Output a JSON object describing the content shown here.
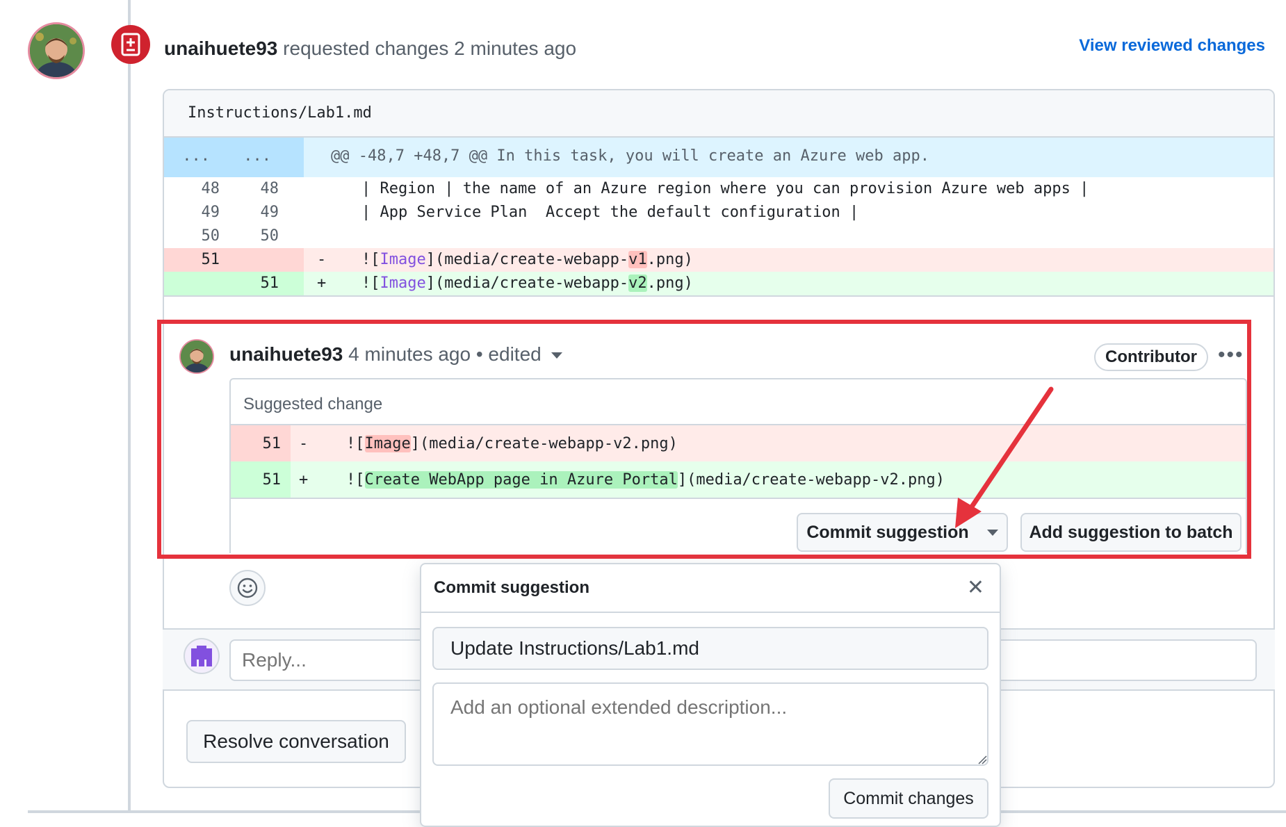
{
  "review": {
    "username": "unaihuete93",
    "action": "requested changes",
    "time": "2 minutes ago",
    "view_link": "View reviewed changes"
  },
  "file": {
    "name": "Instructions/Lab1.md",
    "hunk_left": "...",
    "hunk_right": "...",
    "hunk_header": "@@ -48,7 +48,7 @@ In this task, you will create an Azure web app.",
    "lines": [
      {
        "old": "48",
        "new": "48",
        "marker": "",
        "text": "| Region | the name of an Azure region where you can provision Azure web apps |",
        "type": "ctx"
      },
      {
        "old": "49",
        "new": "49",
        "marker": "",
        "text": "| App Service Plan  Accept the default configuration |",
        "type": "ctx"
      },
      {
        "old": "50",
        "new": "50",
        "marker": "",
        "text": "",
        "type": "ctx"
      },
      {
        "old": "51",
        "new": "",
        "marker": "-",
        "type": "del",
        "pre": "![",
        "link": "Image",
        "mid": "](media/create-webapp-",
        "hl": "v1",
        "post": ".png)"
      },
      {
        "old": "",
        "new": "51",
        "marker": "+",
        "type": "add",
        "pre": "![",
        "link": "Image",
        "mid": "](media/create-webapp-",
        "hl": "v2",
        "post": ".png)"
      }
    ]
  },
  "comment": {
    "username": "unaihuete93",
    "time": "4 minutes ago",
    "edited": "• edited",
    "role_badge": "Contributor",
    "more": "•••",
    "suggestion_title": "Suggested change",
    "del_line": {
      "num": "51",
      "marker": "-",
      "pre": "![",
      "hl": "Image",
      "post": "](media/create-webapp-v2.png)"
    },
    "add_line": {
      "num": "51",
      "marker": "+",
      "pre": "![",
      "hl": "Create WebApp page in Azure Portal",
      "post": "](media/create-webapp-v2.png)"
    },
    "commit_button": "Commit suggestion",
    "batch_button": "Add suggestion to batch"
  },
  "reply": {
    "placeholder": "Reply..."
  },
  "resolve_button": "Resolve conversation",
  "popover": {
    "title": "Commit suggestion",
    "close": "✕",
    "commit_message": "Update Instructions/Lab1.md",
    "description_placeholder": "Add an optional extended description...",
    "submit_button": "Commit changes"
  },
  "colors": {
    "accent_link": "#0969da",
    "danger": "#cf222e",
    "annotation_red": "#e5323c"
  }
}
